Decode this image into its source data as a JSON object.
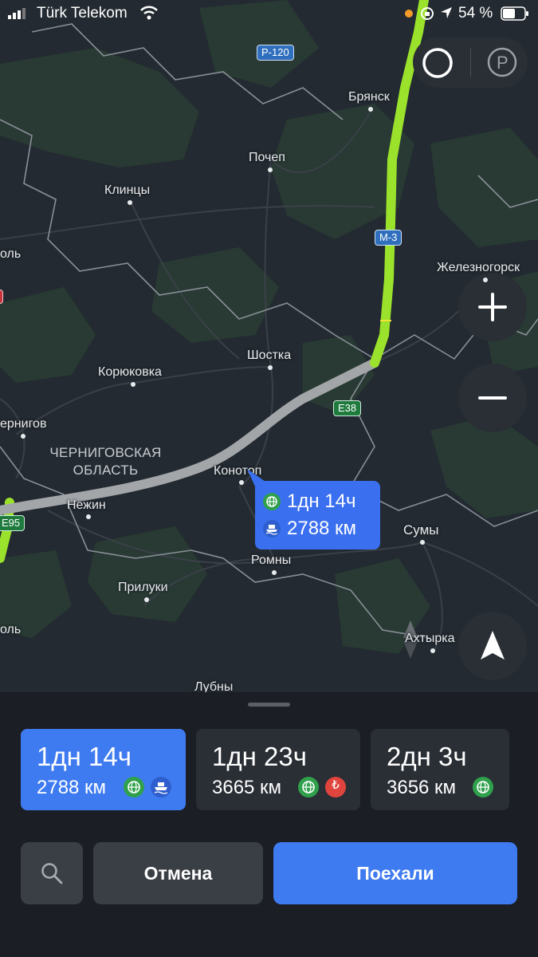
{
  "status_bar": {
    "carrier": "Türk Telekom",
    "battery_percent": "54 %"
  },
  "map": {
    "cities": {
      "bryansk": "Брянск",
      "pochep": "Почеп",
      "klintsy": "Клинцы",
      "zheleznogorsk": "Железногорск",
      "shostka": "Шостка",
      "koryukovka": "Корюковка",
      "chernigov": "ернигов",
      "konotop": "Конотоп",
      "nezhin": "Нежин",
      "sumy": "Сумы",
      "romny": "Ромны",
      "priluki": "Прилуки",
      "akhtyrka": "Ахтырка",
      "lubny": "Лубны",
      "left_top": "оль",
      "left_bottom": "оль"
    },
    "region_label_line1": "ЧЕРНИГОВСКАЯ",
    "region_label_line2": "ОБЛАСТЬ",
    "road_shields": {
      "r120": "Р-120",
      "m3": "М-3",
      "e38": "Е38",
      "e95": "E95"
    },
    "callout": {
      "time": "1дн 14ч",
      "distance": "2788 км"
    },
    "icons": {
      "traffic": "traffic-icon",
      "parking": "parking-icon",
      "compass": "compass-icon",
      "locate": "navigation-arrow-icon"
    }
  },
  "routes": [
    {
      "time": "1дн 14ч",
      "distance": "2788 км",
      "selected": true
    },
    {
      "time": "1дн 23ч",
      "distance": "3665 км",
      "selected": false
    },
    {
      "time": "2дн 3ч",
      "distance": "3656 км",
      "selected": false
    }
  ],
  "actions": {
    "search_icon": "search-icon",
    "cancel_label": "Отмена",
    "go_label": "Поехали"
  },
  "colors": {
    "accent": "#3f7bf0",
    "route_green": "#9be22c",
    "route_gray": "#a3a6a9",
    "toll_red": "#e0453d",
    "globe_green": "#2fa04c"
  }
}
